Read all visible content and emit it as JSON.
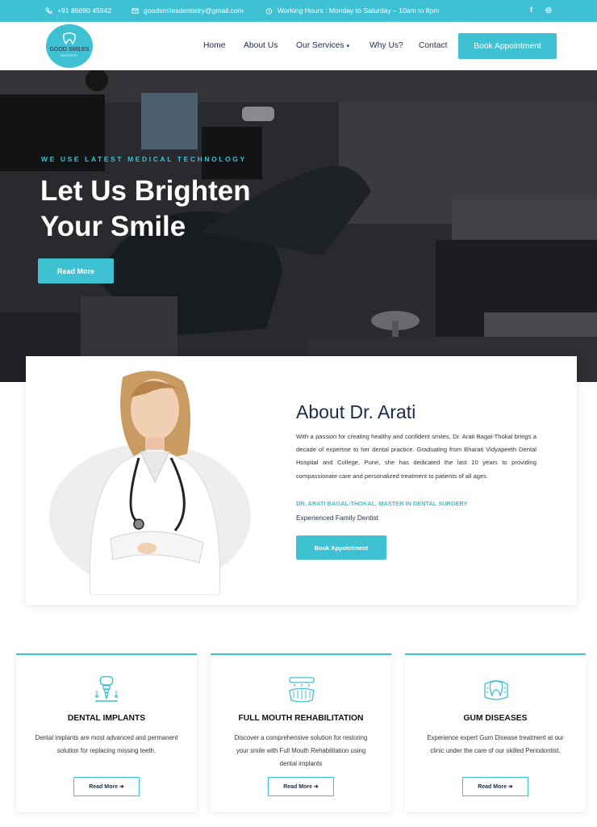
{
  "topbar": {
    "phone": "+91 86690 45942",
    "email": "goodsmilesdentistry@gmail.com",
    "hours": "Working Hours : Monday to Saturday – 10am to 8pm",
    "social": [
      "f",
      "◎"
    ]
  },
  "header": {
    "logo": {
      "brand_line1": "GOOD SMILES",
      "brand_line2": "DENTISTRY"
    },
    "nav": [
      {
        "label": "Home"
      },
      {
        "label": "About Us"
      },
      {
        "label": "Our Services",
        "caret": "▾"
      },
      {
        "label": "Why Us?"
      },
      {
        "label": "Contact"
      }
    ],
    "cta": "Book Appointment"
  },
  "hero": {
    "tagline": "WE USE LATEST MEDICAL TECHNOLOGY",
    "heading_line1": "Let Us Brighten",
    "heading_line2": "Your Smile",
    "button": "Read More"
  },
  "about": {
    "title": "About Dr. Arati",
    "bio": "With a passion for creating healthy and confident smiles, Dr. Arati Bagal-Thokal brings a decade of expertise to her dental practice. Graduating from Bharati Vidyapeeth Dental Hospital and College, Pune, she has dedicated the last 10 years to providing compassionate care and personalized treatment to patients of all ages.",
    "credentials": "DR. ARATI BAGAL-THOKAL, MASTER IN DENTAL SURGERY",
    "role": "Experienced Family Dentist",
    "button": "Book Appointment"
  },
  "services": [
    {
      "title": "DENTAL IMPLANTS",
      "description": "Dental implants are most advanced and permanent solution for replacing missing teeth.",
      "button": "Read More ➔",
      "icon": "dental-implant-icon"
    },
    {
      "title": "FULL MOUTH REHABILITATION",
      "description": "Discover a comprehensive solution for restoring your smile with Full Mouth Rehabilitation using dental implants",
      "button": "Read More ➔",
      "icon": "full-mouth-icon"
    },
    {
      "title": "GUM DISEASES",
      "description": "Experience expert Gum Disease treatment at our clinic under the care of our skilled Periodontist.",
      "button": "Read More ➔",
      "icon": "gum-tooth-icon"
    }
  ],
  "colors": {
    "accent": "#3ec1d3",
    "navy": "#1c2b4a"
  }
}
